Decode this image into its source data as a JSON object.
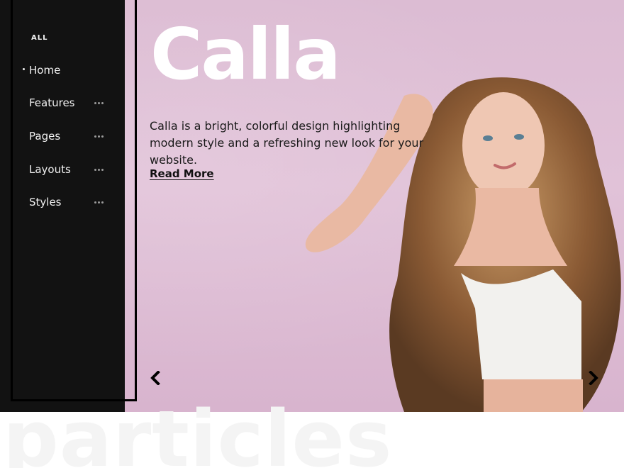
{
  "sidebar": {
    "heading": "ALL",
    "items": [
      {
        "label": "Home",
        "active": true
      },
      {
        "label": "Features"
      },
      {
        "label": "Pages"
      },
      {
        "label": "Layouts"
      },
      {
        "label": "Styles"
      }
    ],
    "more_icon": "more-dots-icon"
  },
  "hero": {
    "title": "Calla",
    "tagline": "Calla is a bright, colorful design highlighting modern style and a refreshing new look for your website.",
    "read_more": "Read More",
    "prev_icon": "chevron-left-icon",
    "next_icon": "chevron-right-icon"
  },
  "watermark": "particles",
  "colors": {
    "sidebar_bg": "#121212",
    "hero_bg": "#dcbcd3",
    "title_color": "#ffffff",
    "text_color": "#1a1a1a"
  }
}
